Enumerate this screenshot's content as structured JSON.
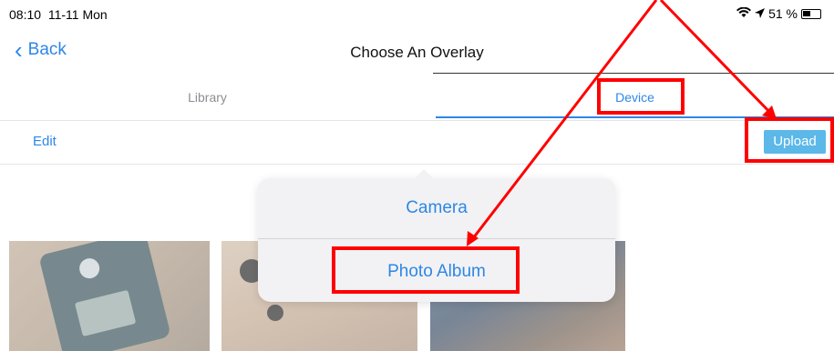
{
  "status_bar": {
    "time": "08:10",
    "date": "11-11 Mon",
    "battery": "51 %"
  },
  "nav": {
    "back_label": "Back",
    "title": "Choose An Overlay"
  },
  "tabs": [
    {
      "label": "Library"
    },
    {
      "label": "Device"
    }
  ],
  "toolbar": {
    "edit_label": "Edit",
    "upload_label": "Upload"
  },
  "popover": {
    "items": [
      {
        "label": "Camera"
      },
      {
        "label": "Photo Album"
      }
    ]
  },
  "colors": {
    "accent": "#2d87e6",
    "upload_bg": "#5bb8e8",
    "annotation": "#ff0000"
  },
  "icons": {
    "back": "chevron-left-icon",
    "wifi": "wifi-icon",
    "location": "location-arrow-icon",
    "battery": "battery-icon"
  }
}
